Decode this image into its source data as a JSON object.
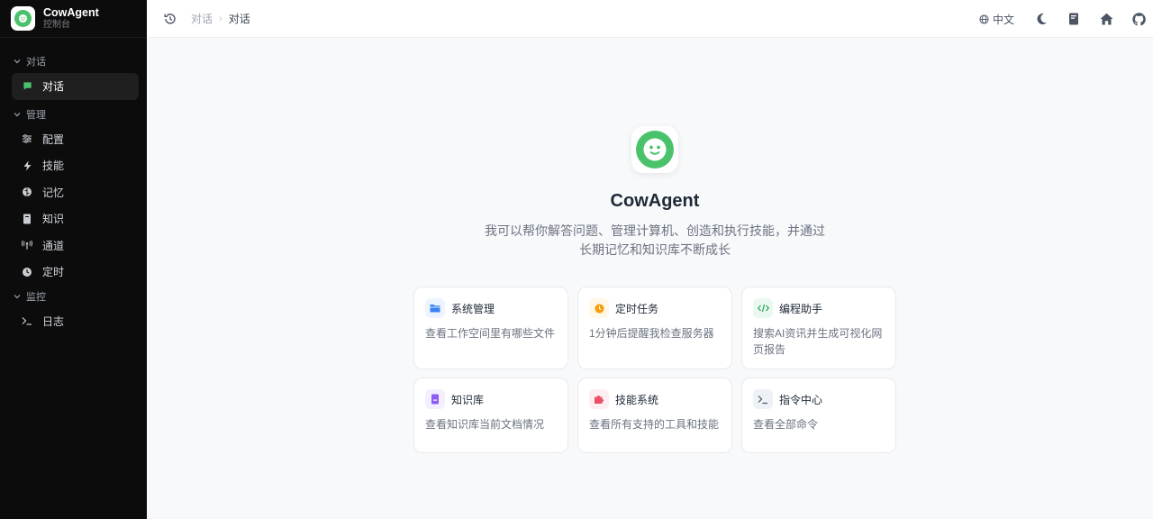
{
  "brand": {
    "name": "CowAgent",
    "subtitle": "控制台",
    "accent": "#4ac26b"
  },
  "sidebar": {
    "sections": [
      {
        "label": "对话",
        "items": [
          {
            "label": "对话",
            "icon": "chat-icon",
            "active": true
          }
        ]
      },
      {
        "label": "管理",
        "items": [
          {
            "label": "配置",
            "icon": "sliders-icon"
          },
          {
            "label": "技能",
            "icon": "bolt-icon"
          },
          {
            "label": "记忆",
            "icon": "brain-icon"
          },
          {
            "label": "知识",
            "icon": "book-icon"
          },
          {
            "label": "通道",
            "icon": "antenna-icon"
          },
          {
            "label": "定时",
            "icon": "clock-icon"
          }
        ]
      },
      {
        "label": "监控",
        "items": [
          {
            "label": "日志",
            "icon": "terminal-icon"
          }
        ]
      }
    ]
  },
  "topbar": {
    "breadcrumb": [
      "对话",
      "对话"
    ],
    "language": "中文",
    "icons": [
      "history-icon",
      "globe-icon",
      "moon-icon",
      "docs-icon",
      "home-icon",
      "github-icon"
    ]
  },
  "hero": {
    "title": "CowAgent",
    "description_line1": "我可以帮你解答问题、管理计算机、创造和执行技能，并通过",
    "description_line2": "长期记忆和知识库不断成长"
  },
  "cards": [
    {
      "title": "系统管理",
      "desc": "查看工作空间里有哪些文件",
      "icon": "folder-icon",
      "color": "#3b82f6",
      "bg": "#eef4ff"
    },
    {
      "title": "定时任务",
      "desc": "1分钟后提醒我检查服务器",
      "icon": "clock-icon",
      "color": "#f59e0b",
      "bg": "#fff7e8"
    },
    {
      "title": "编程助手",
      "desc": "搜索AI资讯并生成可视化网页报告",
      "icon": "code-icon",
      "color": "#22a55a",
      "bg": "#ebf8f0"
    },
    {
      "title": "知识库",
      "desc": "查看知识库当前文档情况",
      "icon": "book-icon",
      "color": "#8b5cf6",
      "bg": "#f3efff"
    },
    {
      "title": "技能系统",
      "desc": "查看所有支持的工具和技能",
      "icon": "puzzle-icon",
      "color": "#ec4f6a",
      "bg": "#fdeef1"
    },
    {
      "title": "指令中心",
      "desc": "查看全部命令",
      "icon": "terminal-icon",
      "color": "#475569",
      "bg": "#eef1f5"
    }
  ]
}
